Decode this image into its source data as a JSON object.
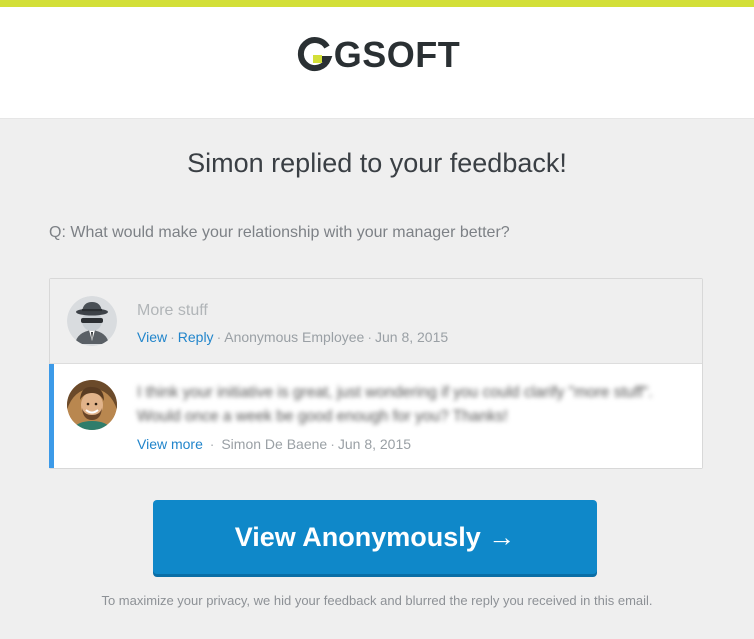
{
  "brand": {
    "name": "GSOFT",
    "accent_color": "#d3df38",
    "text_color": "#2a3033"
  },
  "email": {
    "title": "Simon replied to your feedback!",
    "question": "Q: What would make your relationship with your manager better?"
  },
  "thread": [
    {
      "avatar": "spy-avatar",
      "message": "More stuff",
      "actions": [
        "View",
        "Reply"
      ],
      "author": "Anonymous Employee",
      "date": "Jun 8, 2015"
    },
    {
      "avatar": "user-avatar",
      "message": "I think your initiative is great, just wondering if you could clarify \"more stuff\". Would once a week be good enough for you? Thanks!",
      "action": "View more",
      "author": "Simon De Baene",
      "date": "Jun 8, 2015"
    }
  ],
  "cta": {
    "label": "View Anonymously →",
    "color": "#0f88c9"
  },
  "footer": {
    "note": "To maximize your privacy, we hid your feedback and blurred the reply you received in this email."
  },
  "ui_colors": {
    "reply_accent": "#3c9ae8",
    "link": "#2185cb"
  }
}
